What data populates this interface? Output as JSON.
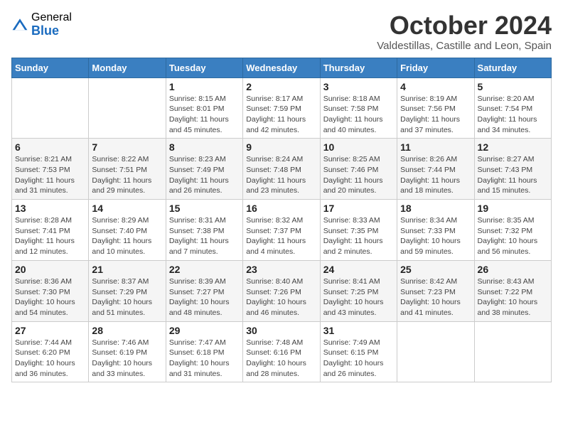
{
  "logo": {
    "general": "General",
    "blue": "Blue"
  },
  "title": "October 2024",
  "location": "Valdestillas, Castille and Leon, Spain",
  "days_of_week": [
    "Sunday",
    "Monday",
    "Tuesday",
    "Wednesday",
    "Thursday",
    "Friday",
    "Saturday"
  ],
  "weeks": [
    [
      {
        "day": "",
        "info": ""
      },
      {
        "day": "",
        "info": ""
      },
      {
        "day": "1",
        "info": "Sunrise: 8:15 AM\nSunset: 8:01 PM\nDaylight: 11 hours and 45 minutes."
      },
      {
        "day": "2",
        "info": "Sunrise: 8:17 AM\nSunset: 7:59 PM\nDaylight: 11 hours and 42 minutes."
      },
      {
        "day": "3",
        "info": "Sunrise: 8:18 AM\nSunset: 7:58 PM\nDaylight: 11 hours and 40 minutes."
      },
      {
        "day": "4",
        "info": "Sunrise: 8:19 AM\nSunset: 7:56 PM\nDaylight: 11 hours and 37 minutes."
      },
      {
        "day": "5",
        "info": "Sunrise: 8:20 AM\nSunset: 7:54 PM\nDaylight: 11 hours and 34 minutes."
      }
    ],
    [
      {
        "day": "6",
        "info": "Sunrise: 8:21 AM\nSunset: 7:53 PM\nDaylight: 11 hours and 31 minutes."
      },
      {
        "day": "7",
        "info": "Sunrise: 8:22 AM\nSunset: 7:51 PM\nDaylight: 11 hours and 29 minutes."
      },
      {
        "day": "8",
        "info": "Sunrise: 8:23 AM\nSunset: 7:49 PM\nDaylight: 11 hours and 26 minutes."
      },
      {
        "day": "9",
        "info": "Sunrise: 8:24 AM\nSunset: 7:48 PM\nDaylight: 11 hours and 23 minutes."
      },
      {
        "day": "10",
        "info": "Sunrise: 8:25 AM\nSunset: 7:46 PM\nDaylight: 11 hours and 20 minutes."
      },
      {
        "day": "11",
        "info": "Sunrise: 8:26 AM\nSunset: 7:44 PM\nDaylight: 11 hours and 18 minutes."
      },
      {
        "day": "12",
        "info": "Sunrise: 8:27 AM\nSunset: 7:43 PM\nDaylight: 11 hours and 15 minutes."
      }
    ],
    [
      {
        "day": "13",
        "info": "Sunrise: 8:28 AM\nSunset: 7:41 PM\nDaylight: 11 hours and 12 minutes."
      },
      {
        "day": "14",
        "info": "Sunrise: 8:29 AM\nSunset: 7:40 PM\nDaylight: 11 hours and 10 minutes."
      },
      {
        "day": "15",
        "info": "Sunrise: 8:31 AM\nSunset: 7:38 PM\nDaylight: 11 hours and 7 minutes."
      },
      {
        "day": "16",
        "info": "Sunrise: 8:32 AM\nSunset: 7:37 PM\nDaylight: 11 hours and 4 minutes."
      },
      {
        "day": "17",
        "info": "Sunrise: 8:33 AM\nSunset: 7:35 PM\nDaylight: 11 hours and 2 minutes."
      },
      {
        "day": "18",
        "info": "Sunrise: 8:34 AM\nSunset: 7:33 PM\nDaylight: 10 hours and 59 minutes."
      },
      {
        "day": "19",
        "info": "Sunrise: 8:35 AM\nSunset: 7:32 PM\nDaylight: 10 hours and 56 minutes."
      }
    ],
    [
      {
        "day": "20",
        "info": "Sunrise: 8:36 AM\nSunset: 7:30 PM\nDaylight: 10 hours and 54 minutes."
      },
      {
        "day": "21",
        "info": "Sunrise: 8:37 AM\nSunset: 7:29 PM\nDaylight: 10 hours and 51 minutes."
      },
      {
        "day": "22",
        "info": "Sunrise: 8:39 AM\nSunset: 7:27 PM\nDaylight: 10 hours and 48 minutes."
      },
      {
        "day": "23",
        "info": "Sunrise: 8:40 AM\nSunset: 7:26 PM\nDaylight: 10 hours and 46 minutes."
      },
      {
        "day": "24",
        "info": "Sunrise: 8:41 AM\nSunset: 7:25 PM\nDaylight: 10 hours and 43 minutes."
      },
      {
        "day": "25",
        "info": "Sunrise: 8:42 AM\nSunset: 7:23 PM\nDaylight: 10 hours and 41 minutes."
      },
      {
        "day": "26",
        "info": "Sunrise: 8:43 AM\nSunset: 7:22 PM\nDaylight: 10 hours and 38 minutes."
      }
    ],
    [
      {
        "day": "27",
        "info": "Sunrise: 7:44 AM\nSunset: 6:20 PM\nDaylight: 10 hours and 36 minutes."
      },
      {
        "day": "28",
        "info": "Sunrise: 7:46 AM\nSunset: 6:19 PM\nDaylight: 10 hours and 33 minutes."
      },
      {
        "day": "29",
        "info": "Sunrise: 7:47 AM\nSunset: 6:18 PM\nDaylight: 10 hours and 31 minutes."
      },
      {
        "day": "30",
        "info": "Sunrise: 7:48 AM\nSunset: 6:16 PM\nDaylight: 10 hours and 28 minutes."
      },
      {
        "day": "31",
        "info": "Sunrise: 7:49 AM\nSunset: 6:15 PM\nDaylight: 10 hours and 26 minutes."
      },
      {
        "day": "",
        "info": ""
      },
      {
        "day": "",
        "info": ""
      }
    ]
  ]
}
